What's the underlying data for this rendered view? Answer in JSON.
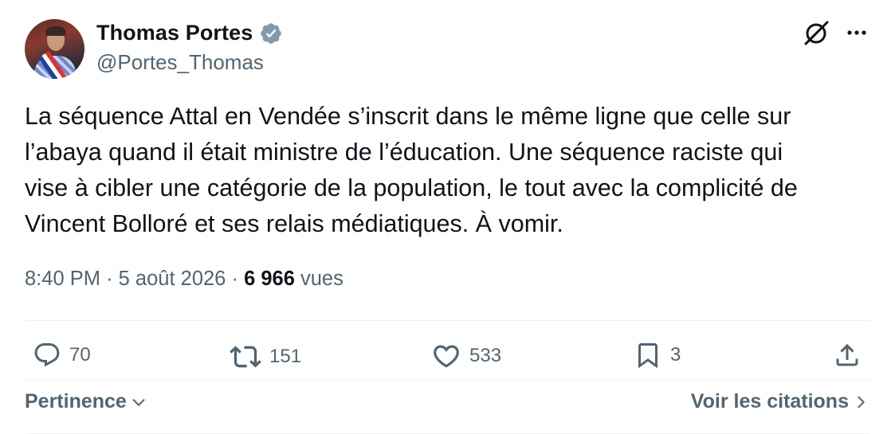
{
  "author": {
    "display_name": "Thomas Portes",
    "handle": "@Portes_Thomas",
    "verified": true
  },
  "icons": {
    "verified": "verified-badge-icon",
    "grok": "grok-icon",
    "more": "more-icon",
    "reply": "reply-icon",
    "retweet": "retweet-icon",
    "like": "like-icon",
    "bookmark": "bookmark-icon",
    "share": "share-icon",
    "chevron_down": "chevron-down-icon",
    "chevron_right": "chevron-right-icon"
  },
  "tweet": {
    "lines": [
      "La séquence Attal en Vendée s’inscrit dans le même ligne que celle sur",
      "l’abaya quand il était ministre de l’éducation. Une séquence raciste qui",
      "vise à cibler une catégorie de la population, le tout avec la complicité de",
      "Vincent Bolloré et ses relais médiatiques. À vomir."
    ],
    "time": "8:40 PM",
    "separator": "·",
    "date": "5 août 2026",
    "views_count": "6 966",
    "views_label": "vues"
  },
  "actions": {
    "replies": "70",
    "reposts": "151",
    "likes": "533",
    "bookmarks": "3"
  },
  "footer": {
    "sort_label": "Pertinence",
    "quotes_label": "Voir les citations"
  },
  "colors": {
    "text_primary": "#0f1419",
    "text_secondary": "#536471",
    "divider": "#eff3f4",
    "verified_badge": "#829aab"
  }
}
